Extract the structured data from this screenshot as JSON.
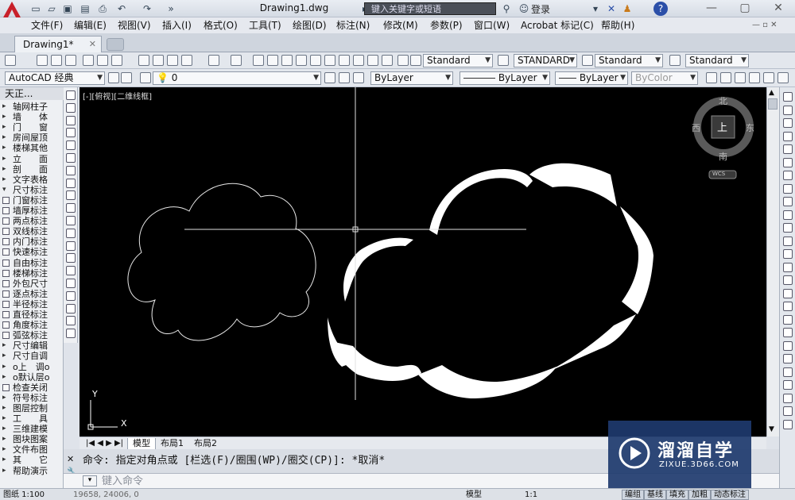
{
  "titlebar": {
    "doc_title": "Drawing1.dwg",
    "search_placeholder": "键入关键字或短语",
    "login": "登录"
  },
  "menu": [
    "文件(F)",
    "编辑(E)",
    "视图(V)",
    "插入(I)",
    "格式(O)",
    "工具(T)",
    "绘图(D)",
    "标注(N)",
    "修改(M)",
    "参数(P)",
    "窗口(W)",
    "Acrobat 标记(C)",
    "帮助(H)"
  ],
  "doc_tab": "Drawing1*",
  "styles_toolbar": {
    "text_style": "Standard",
    "dim_style": "STANDARD",
    "table_style": "Standard",
    "mleader_style": "Standard"
  },
  "workspace_toolbar": {
    "workspace": "AutoCAD 经典",
    "layer": "0",
    "color": "ByLayer",
    "linetype": "ByLayer",
    "lineweight": "ByLayer",
    "plotstyle": "ByColor"
  },
  "left_panel": {
    "header": "天正...",
    "items": [
      {
        "label": "轴网柱子",
        "kind": "tri"
      },
      {
        "label": "墙　　体",
        "kind": "tri"
      },
      {
        "label": "门　　窗",
        "kind": "tri"
      },
      {
        "label": "房间屋顶",
        "kind": "tri"
      },
      {
        "label": "楼梯其他",
        "kind": "tri"
      },
      {
        "label": "立　　面",
        "kind": "tri"
      },
      {
        "label": "剖　　面",
        "kind": "tri"
      },
      {
        "label": "文字表格",
        "kind": "tri"
      },
      {
        "label": "尺寸标注",
        "kind": "tri-open"
      },
      {
        "label": "门窗标注",
        "kind": "icon"
      },
      {
        "label": "墙厚标注",
        "kind": "icon"
      },
      {
        "label": "两点标注",
        "kind": "icon"
      },
      {
        "label": "双线标注",
        "kind": "icon"
      },
      {
        "label": "内门标注",
        "kind": "icon"
      },
      {
        "label": "快速标注",
        "kind": "icon"
      },
      {
        "label": "自由标注",
        "kind": "icon"
      },
      {
        "label": "楼梯标注",
        "kind": "icon"
      },
      {
        "label": "外包尺寸",
        "kind": "icon"
      },
      {
        "label": "逐点标注",
        "kind": "icon"
      },
      {
        "label": "半径标注",
        "kind": "icon"
      },
      {
        "label": "直径标注",
        "kind": "icon"
      },
      {
        "label": "角度标注",
        "kind": "icon"
      },
      {
        "label": "弧弦标注",
        "kind": "icon"
      },
      {
        "label": "尺寸编辑",
        "kind": "tri"
      },
      {
        "label": "尺寸自调",
        "kind": "tri"
      },
      {
        "label": "o上　调o",
        "kind": "tri"
      },
      {
        "label": "o默认层o",
        "kind": "tri"
      },
      {
        "label": "检查关闭",
        "kind": "icon"
      },
      {
        "label": "符号标注",
        "kind": "tri"
      },
      {
        "label": "图层控制",
        "kind": "tri"
      },
      {
        "label": "工　　具",
        "kind": "tri"
      },
      {
        "label": "三维建模",
        "kind": "tri"
      },
      {
        "label": "图块图案",
        "kind": "tri"
      },
      {
        "label": "文件布图",
        "kind": "tri"
      },
      {
        "label": "其　　它",
        "kind": "tri"
      },
      {
        "label": "帮助演示",
        "kind": "tri"
      }
    ]
  },
  "canvas": {
    "viewport_label": "[-][俯视][二维线框]",
    "viewcube": {
      "north": "北",
      "south": "南",
      "east": "东",
      "west": "西",
      "top": "上",
      "wcs": "WCS"
    },
    "ucs": {
      "x": "X",
      "y": "Y"
    }
  },
  "layout_tabs": [
    "模型",
    "布局1",
    "布局2"
  ],
  "command": {
    "history": "命令: 指定对角点或 [栏选(F)/圈围(WP)/圈交(CP)]: *取消*",
    "placeholder": "键入命令"
  },
  "statusbar": {
    "scale": "图纸 1:100",
    "coords": "19658, 24006, 0",
    "model": "模型",
    "annotation_scale": "1:1",
    "buttons": [
      "编组",
      "基线",
      "填充",
      "加粗",
      "动态标注"
    ]
  },
  "watermark": {
    "brand": "溜溜自学",
    "url": "ZIXUE.3D66.COM"
  },
  "colors": {
    "canvas": "#000000",
    "drawing": "#ffffff",
    "accent": "#c8202a"
  }
}
